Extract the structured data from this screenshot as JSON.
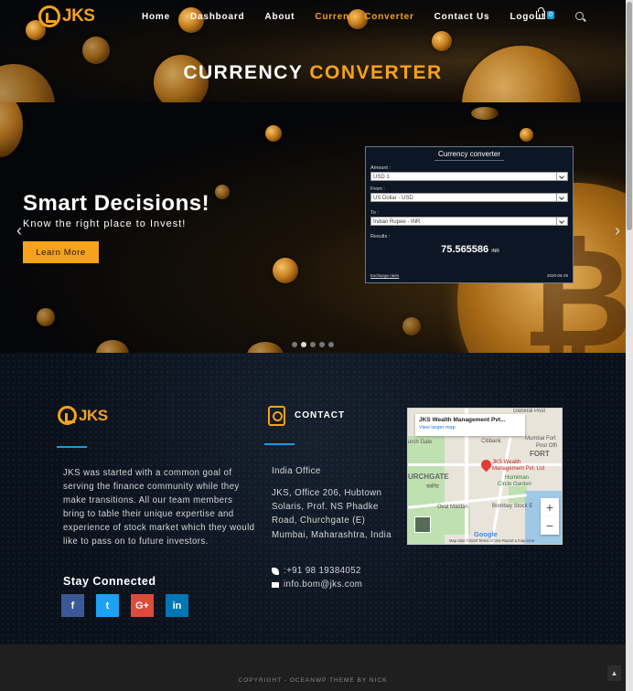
{
  "brand": {
    "logo_text": "JKS",
    "accent_color": "#f6a21a",
    "link_color": "#1e9bd7"
  },
  "nav": {
    "items": [
      {
        "label": "Home"
      },
      {
        "label": "Dashboard"
      },
      {
        "label": "About"
      },
      {
        "label": "Currency Converter",
        "active": true
      },
      {
        "label": "Contact Us"
      },
      {
        "label": "Logout"
      }
    ],
    "cart_count": "0",
    "search_icon": "search-icon"
  },
  "hero": {
    "title_part1": "CURRENCY",
    "title_part2": "CONVERTER"
  },
  "slider": {
    "heading": "Smart Decisions!",
    "subtext": "Know the right place to Invest!",
    "button_label": "Learn More",
    "prev_icon": "chevron-left-icon",
    "next_icon": "chevron-right-icon",
    "dot_count": 5,
    "active_dot": 1
  },
  "converter": {
    "title": "Currency converter",
    "amount_label": "Amount :",
    "amount_currency": "USD",
    "amount_value": "1",
    "from_label": "From :",
    "from_value": "US Dollar - USD",
    "to_label": "To :",
    "to_value": "Indian Rupee - INR",
    "results_label": "Results :",
    "result_value": "75.565586",
    "result_unit": "INR",
    "exchange_rates_link": "Exchange rates",
    "date": "2020-05-29"
  },
  "footer": {
    "logo_text": "JKS",
    "about_text": "JKS was started with a common goal of serving the finance community while they make transitions. All our team members bring to table their unique expertise and experience of stock market which they would like to pass on to future investors.",
    "stay_connected": "Stay Connected",
    "social": [
      {
        "name": "facebook",
        "glyph": "f",
        "color": "#3b5998"
      },
      {
        "name": "twitter",
        "glyph": "t",
        "color": "#1da1f2"
      },
      {
        "name": "google-plus",
        "glyph": "G+",
        "color": "#dd4b39"
      },
      {
        "name": "linkedin",
        "glyph": "in",
        "color": "#0077b5"
      }
    ],
    "contact_title": "CONTACT",
    "office_label": "India Office",
    "address": "JKS, Office 206, Hubtown Solaris, Prof. NS Phadke Road, Churchgate (E) Mumbai, Maharashtra, India",
    "phone": ":+91 98 19384052",
    "email": "info.bom@jks.com"
  },
  "map": {
    "place_name": "JKS Wealth Management Pvt...",
    "view_larger": "View larger map",
    "pin_label_line1": "JKS Wealth",
    "pin_label_line2": "Management Pvt. Ltd",
    "labels": {
      "general_post": "General Post",
      "citibank": "Citibank",
      "mumbai_fort": "Mumbai Fort",
      "post_office": "Post Offi",
      "fort": "FORT",
      "church_gate": "urch Gate",
      "churchgate_area": "URCHGATE",
      "churchgate_devanagari": "चर्चगेट",
      "horniman1": "Horniman",
      "horniman2": "Circle Garden",
      "oval_maidan": "Oval Maidan",
      "bombay_stock": "Bombay Stock E"
    },
    "zoom_in": "+",
    "zoom_out": "−",
    "google": "Google",
    "attribution": "Map data ©2020   Terms of Use   Report a map error"
  },
  "bottom": {
    "copyright": "COPYRIGHT - OCEANWP THEME BY NICK",
    "scroll_top_icon": "chevron-up-icon"
  }
}
